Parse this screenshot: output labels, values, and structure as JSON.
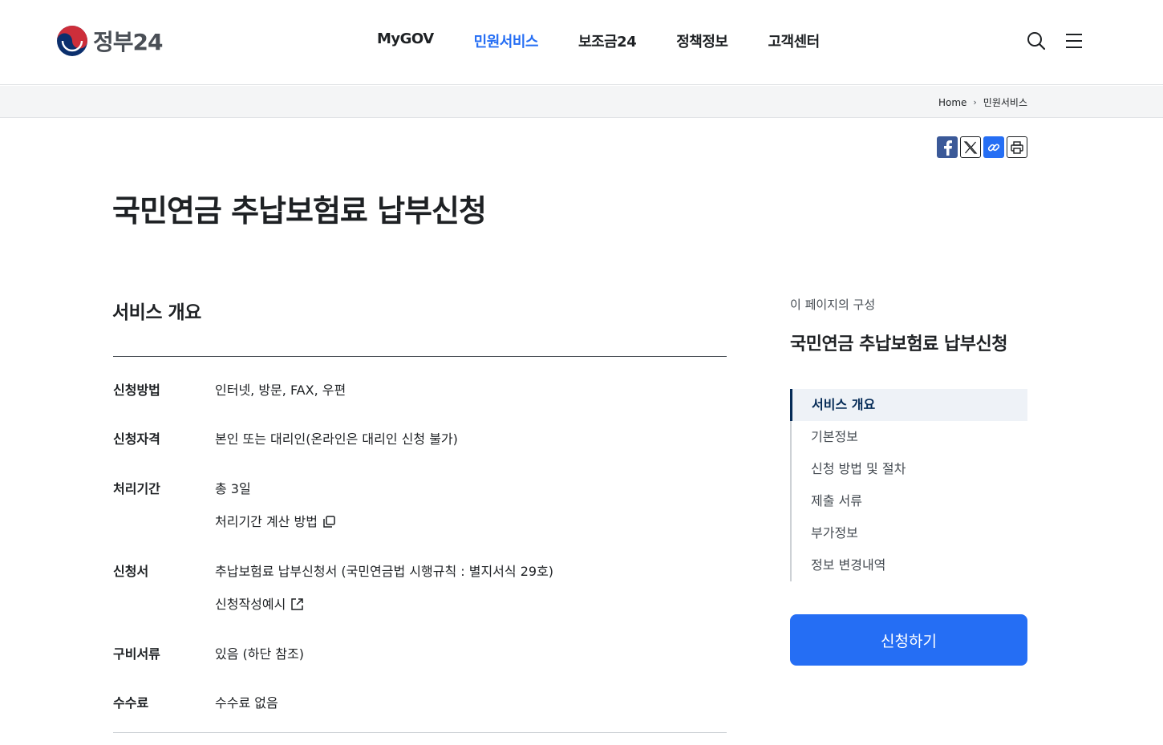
{
  "header": {
    "logo_text": "정부24",
    "nav": [
      "MyGOV",
      "민원서비스",
      "보조금24",
      "정책정보",
      "고객센터"
    ],
    "active_nav_index": 1
  },
  "breadcrumb": {
    "home": "Home",
    "current": "민원서비스"
  },
  "page": {
    "title": "국민연금 추납보험료 납부신청"
  },
  "overview": {
    "title": "서비스 개요",
    "rows": [
      {
        "label": "신청방법",
        "values": [
          "인터넷, 방문, FAX, 우편"
        ]
      },
      {
        "label": "신청자격",
        "values": [
          "본인 또는 대리인(온라인은 대리인 신청 불가)"
        ]
      },
      {
        "label": "처리기간",
        "values": [
          "총 3일",
          "처리기간 계산 방법"
        ]
      },
      {
        "label": "신청서",
        "values": [
          "추납보험료 납부신청서 (국민연금법 시행규칙 : 별지서식 29호)",
          "신청작성예시"
        ]
      },
      {
        "label": "구비서류",
        "values": [
          "있음 (하단 참조)"
        ]
      },
      {
        "label": "수수료",
        "values": [
          "수수료 없음"
        ]
      }
    ]
  },
  "toc": {
    "caption": "이 페이지의 구성",
    "title": "국민연금 추납보험료 납부신청",
    "items": [
      "서비스 개요",
      "기본정보",
      "신청 방법 및 절차",
      "제출 서류",
      "부가정보",
      "정보 변경내역"
    ],
    "active_index": 0
  },
  "apply_button": "신청하기",
  "colors": {
    "primary": "#256ef4",
    "navy": "#052b57",
    "text": "#1e2124"
  }
}
